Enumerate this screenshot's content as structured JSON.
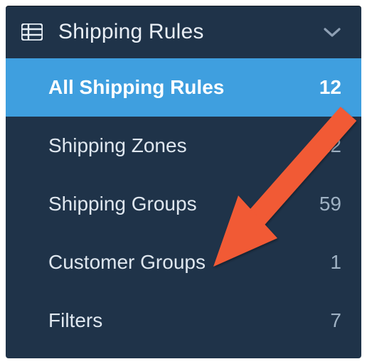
{
  "header": {
    "title": "Shipping Rules"
  },
  "menu": {
    "items": [
      {
        "label": "All Shipping Rules",
        "count": "12",
        "active": true
      },
      {
        "label": "Shipping Zones",
        "count": "22",
        "active": false
      },
      {
        "label": "Shipping Groups",
        "count": "59",
        "active": false
      },
      {
        "label": "Customer Groups",
        "count": "1",
        "active": false
      },
      {
        "label": "Filters",
        "count": "7",
        "active": false
      }
    ]
  },
  "annotation": {
    "arrow_color": "#f15a36"
  }
}
